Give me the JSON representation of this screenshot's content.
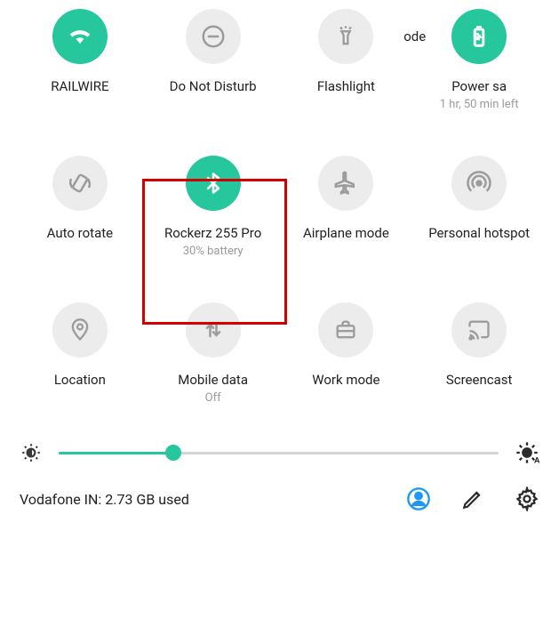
{
  "tiles": [
    {
      "label": "RAILWIRE",
      "sub": "",
      "active": true,
      "icon": "wifi"
    },
    {
      "label": "Do Not Disturb",
      "sub": "",
      "active": false,
      "icon": "dnd"
    },
    {
      "label": "Flashlight",
      "sub": "",
      "active": false,
      "icon": "flashlight"
    },
    {
      "label": "Power sa",
      "sub": "1 hr, 50 min left",
      "active": true,
      "icon": "battery",
      "prefix": "ode"
    },
    {
      "label": "Auto rotate",
      "sub": "",
      "active": false,
      "icon": "rotate"
    },
    {
      "label": "Rockerz 255 Pro",
      "sub": "30% battery",
      "active": true,
      "icon": "bluetooth"
    },
    {
      "label": "Airplane mode",
      "sub": "",
      "active": false,
      "icon": "airplane"
    },
    {
      "label": "Personal hotspot",
      "sub": "",
      "active": false,
      "icon": "hotspot"
    },
    {
      "label": "Location",
      "sub": "",
      "active": false,
      "icon": "location"
    },
    {
      "label": "Mobile data",
      "sub": "Off",
      "active": false,
      "icon": "data"
    },
    {
      "label": "Work mode",
      "sub": "",
      "active": false,
      "icon": "work"
    },
    {
      "label": "Screencast",
      "sub": "",
      "active": false,
      "icon": "cast"
    }
  ],
  "brightness": {
    "percent": 26
  },
  "footer": {
    "carrier_text": "Vodafone IN: 2.73 GB used"
  },
  "colors": {
    "accent": "#26c79d",
    "inactive": "#ececec",
    "highlight": "#d40000",
    "profile": "#2098f3"
  }
}
